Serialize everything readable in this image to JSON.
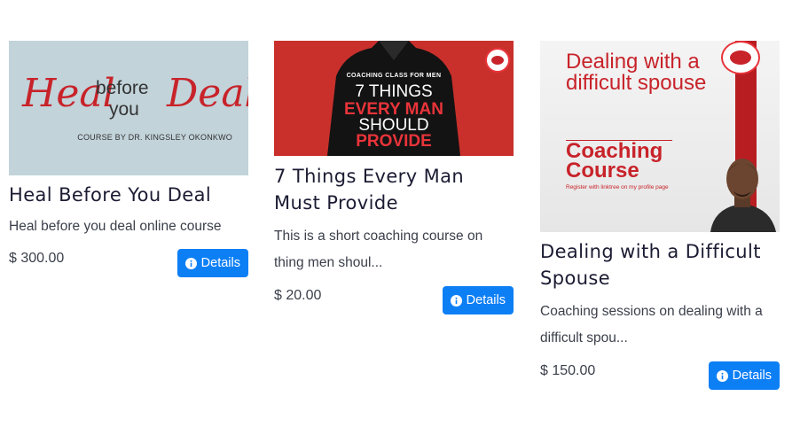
{
  "courses": [
    {
      "title": "Heal Before You Deal",
      "description": "Heal before you deal online course",
      "price": "$ 300.00",
      "details_label": "Details",
      "thumbnail": {
        "word_heal": "Heal",
        "word_before": "before",
        "word_you": "you",
        "word_deal": "Deal",
        "byline": "COURSE BY DR. KINGSLEY OKONKWO"
      }
    },
    {
      "title": "7 Things Every Man Must Provide",
      "description": "This is a short coaching course on thing men shoul...",
      "price": "$ 20.00",
      "details_label": "Details",
      "thumbnail": {
        "kicker": "COACHING CLASS FOR MEN",
        "line1": "7 THINGS",
        "line2": "EVERY MAN",
        "line3": "SHOULD",
        "line4": "PROVIDE"
      }
    },
    {
      "title": "Dealing with a Difficult Spouse",
      "description": "Coaching sessions on dealing with a difficult spou...",
      "price": "$ 150.00",
      "details_label": "Details",
      "thumbnail": {
        "headline": "Dealing with a difficult spouse",
        "coaching": "Coaching Course",
        "register": "Register with linktree on my profile page"
      }
    }
  ],
  "colors": {
    "button": "#0d7ff5",
    "brand_red": "#c8232a",
    "title_text": "#1b1b33",
    "body_text": "#3a3f4a"
  },
  "icons": {
    "details": "info-circle-icon"
  }
}
